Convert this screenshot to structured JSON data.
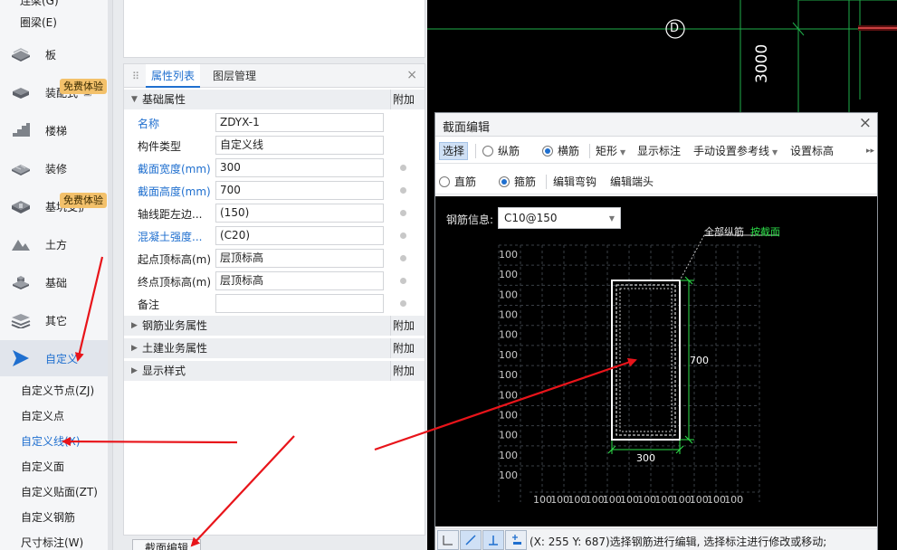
{
  "nav": {
    "top_items": [
      "连梁(G)",
      "圈梁(E)"
    ],
    "items": [
      {
        "label": "板",
        "icon": "slab-icon"
      },
      {
        "label": "装配式",
        "icon": "prefab-icon"
      },
      {
        "label": "楼梯",
        "icon": "stairs-icon"
      },
      {
        "label": "装修",
        "icon": "decoration-icon"
      },
      {
        "label": "基坑支护",
        "icon": "pit-support-icon"
      },
      {
        "label": "土方",
        "icon": "earthwork-icon"
      },
      {
        "label": "基础",
        "icon": "foundation-icon"
      },
      {
        "label": "其它",
        "icon": "other-icon"
      },
      {
        "label": "自定义",
        "icon": "custom-icon"
      }
    ],
    "badges": [
      "免费体验",
      "免费体验"
    ],
    "sub_items": [
      "自定义节点(ZJ)",
      "自定义点",
      "自定义线(X)",
      "自定义面",
      "自定义贴面(ZT)",
      "自定义钢筋",
      "尺寸标注(W)"
    ],
    "selected_sub": "自定义线(X)"
  },
  "props": {
    "tabs": [
      "属性列表",
      "图层管理"
    ],
    "groups": {
      "basic": "基础属性",
      "rebar": "钢筋业务属性",
      "civil": "土建业务属性",
      "display": "显示样式",
      "add": "附加"
    },
    "rows": [
      {
        "name": "名称",
        "value": "ZDYX-1",
        "blue": true,
        "dot": false
      },
      {
        "name": "构件类型",
        "value": "自定义线",
        "blue": false,
        "dot": false
      },
      {
        "name": "截面宽度(mm)",
        "value": "300",
        "blue": true,
        "dot": true
      },
      {
        "name": "截面高度(mm)",
        "value": "700",
        "blue": true,
        "dot": true
      },
      {
        "name": "轴线距左边...",
        "value": "(150)",
        "blue": false,
        "dot": true
      },
      {
        "name": "混凝土强度...",
        "value": "(C20)",
        "blue": true,
        "dot": true
      },
      {
        "name": "起点顶标高(m)",
        "value": "层顶标高",
        "blue": false,
        "dot": true
      },
      {
        "name": "终点顶标高(m)",
        "value": "层顶标高",
        "blue": false,
        "dot": true
      },
      {
        "name": "备注",
        "value": "",
        "blue": false,
        "dot": true
      }
    ],
    "section_button": "截面编辑"
  },
  "cad": {
    "axis_label": "D",
    "dimension": "3000"
  },
  "dialog": {
    "title": "截面编辑",
    "toolbar1": {
      "select": "选择",
      "longitudinal": "纵筋",
      "stirrup_horizontal": "横筋",
      "rectangle": "矩形",
      "show_dims": "显示标注",
      "manual_ref": "手动设置参考线",
      "set_elevation": "设置标高"
    },
    "toolbar2": {
      "straight": "直筋",
      "stirrup": "箍筋",
      "edit_hook": "编辑弯钩",
      "edit_end": "编辑端头"
    },
    "rebar_info_label": "钢筋信息:",
    "rebar_value": "C10@150",
    "all_longitudinal": "全部纵筋",
    "by_section": "按截面",
    "grid_value": "100",
    "dim_height": "700",
    "dim_width": "300",
    "status": "(X: 255 Y: 687)选择钢筋进行编辑, 选择标注进行修改或移动;"
  },
  "colors": {
    "accent": "#1f6fcf",
    "cad_grid": "#1fae4a",
    "arrow": "#e8141a",
    "badge": "#f3c16b"
  }
}
